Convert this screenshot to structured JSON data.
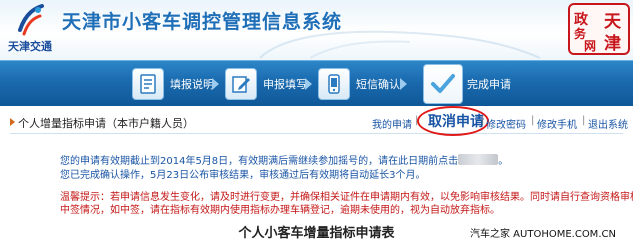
{
  "header": {
    "logo_text": "天津交通",
    "site_title": "天津市小客车调控管理信息系统",
    "seal_chars": [
      "天",
      "津",
      "政",
      "务",
      "网"
    ]
  },
  "steps": [
    {
      "label": "填报说明",
      "icon": "document-icon"
    },
    {
      "label": "申报填写",
      "icon": "edit-icon"
    },
    {
      "label": "短信确认",
      "icon": "phone-icon"
    },
    {
      "label": "完成申请",
      "icon": "check-icon"
    }
  ],
  "subnav": {
    "title": "个人增量指标申请（本市户籍人员）",
    "my_application": "我的申请",
    "cancel_application": "取消申请",
    "change_password": "修改密码",
    "change_phone": "修改手机",
    "logout": "退出系统"
  },
  "messages": {
    "line1_pre": "您的申请有效期截止到2014年5月8日，有效期满后需继续参加摇号的，请在此日期前点击",
    "line1_post": "。",
    "line2": "您已完成确认操作，5月23日公布审核结果，审核通过后有效期将自动延长3个月。",
    "warn1": "温馨提示：若申请信息发生变化，请及时进行变更，并确保相关证件在申请期内有效，以免影响审核结果。同时请自行查询资格审核及",
    "warn2": "中签情况，如中签，请在指标有效期内使用指标办理车辆登记，逾期未使用的，视为自动放弃指标。"
  },
  "form_title": "个人小客车增量指标申请表",
  "watermark": "汽车之家 AUTOHOME.COM.CN",
  "colors": {
    "brand_blue": "#1f6fb8",
    "step_bar": "#1a6aae",
    "link": "#1a55a5",
    "warning_red": "#c41717",
    "highlight_circle": "#e01818"
  }
}
